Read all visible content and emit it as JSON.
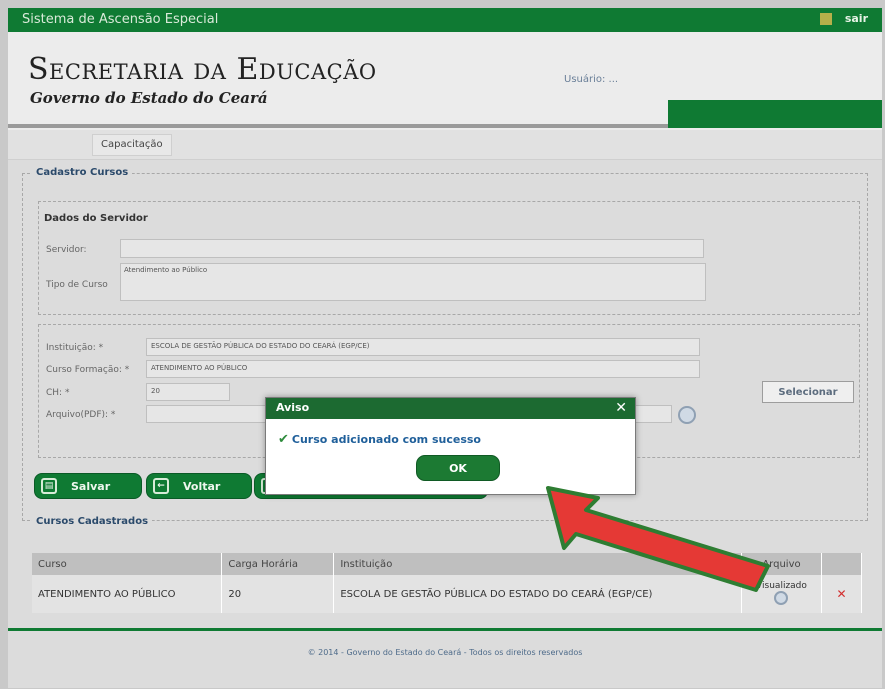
{
  "app": {
    "title": "Sistema de Ascensão Especial",
    "logout": "sair"
  },
  "header": {
    "title": "Secretaria da Educação",
    "subtitle": "Governo do Estado do Ceará",
    "user_label": "Usuário:  ..."
  },
  "nav": {
    "items": [
      "Capacitação"
    ]
  },
  "form": {
    "legend": "Cadastro Cursos",
    "servidor_section": "Dados do Servidor",
    "servidor_label": "Servidor:",
    "servidor_value": "",
    "tipo_label": "Tipo de Curso",
    "tipo_value": "Atendimento ao Público",
    "instituicao_label": "Instituição: *",
    "instituicao_value": "ESCOLA DE GESTÃO PÚBLICA DO ESTADO DO CEARÁ (EGP/CE)",
    "curso_label": "Curso Formação: *",
    "curso_value": "ATENDIMENTO AO PÚBLICO",
    "ch_label": "CH: *",
    "ch_value": "20",
    "arquivo_label": "Arquivo(PDF): *",
    "selecionar_label": "Selecionar"
  },
  "actions": {
    "salvar": "Salvar",
    "voltar": "Voltar",
    "hidden": "..."
  },
  "cursos": {
    "legend": "Cursos Cadastrados",
    "columns": [
      "Curso",
      "Carga Horária",
      "Instituição",
      "Arquivo"
    ],
    "rows": [
      {
        "curso": "ATENDIMENTO AO PÚBLICO",
        "ch": "20",
        "instituicao": "ESCOLA DE GESTÃO PÚBLICA DO ESTADO DO CEARÁ (EGP/CE)",
        "arquivo": "Visualizado"
      }
    ]
  },
  "footer": {
    "text": "© 2014 - Governo do Estado do Ceará - Todos os direitos reservados"
  },
  "dialog": {
    "title": "Aviso",
    "message": "Curso adicionado com sucesso",
    "ok": "OK"
  },
  "colors": {
    "brand_green": "#0f7a33",
    "arrow_red": "#e53935",
    "arrow_border": "#2e7d32"
  }
}
